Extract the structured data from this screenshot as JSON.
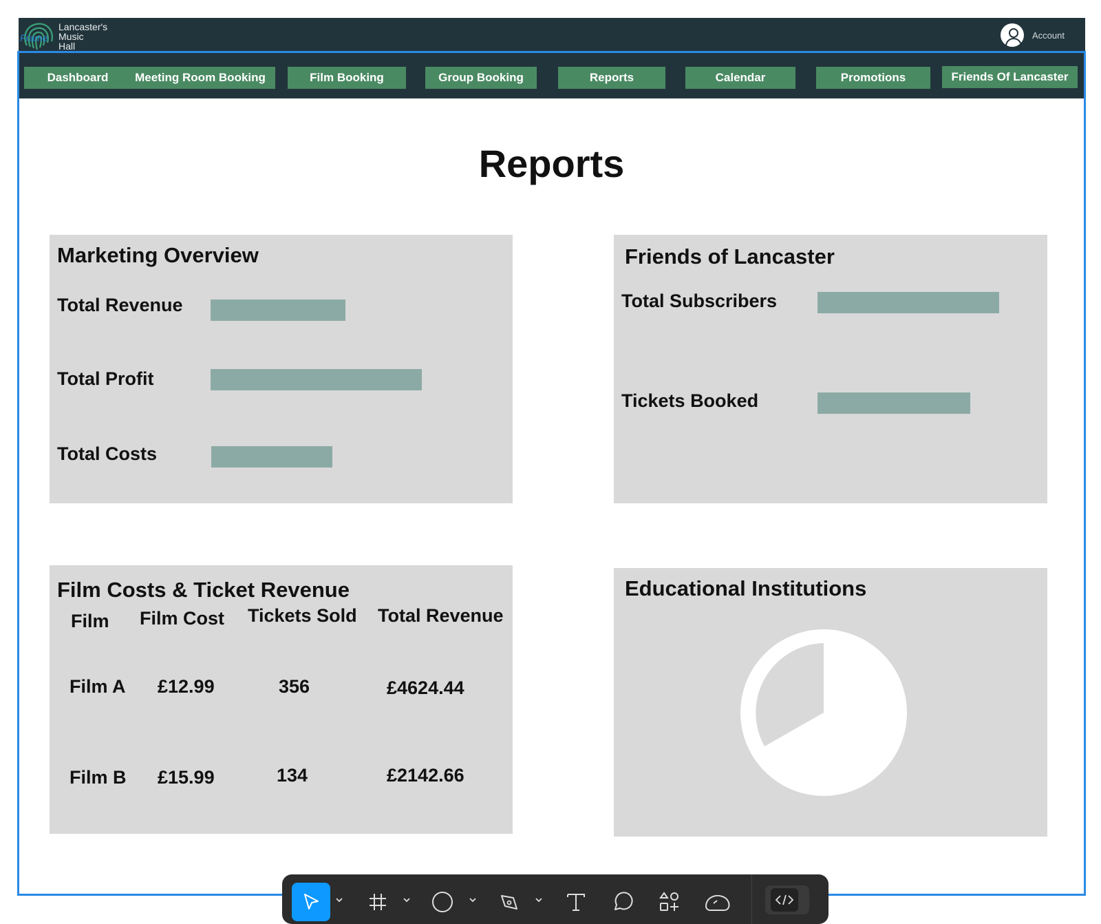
{
  "app": {
    "logo_lines": [
      "Lancaster's",
      "Music",
      "Hall"
    ],
    "frame_label": "Frame",
    "account_label": "Account"
  },
  "nav": {
    "items": [
      {
        "label": "Dashboard"
      },
      {
        "label": "Meeting Room Booking"
      },
      {
        "label": "Film Booking"
      },
      {
        "label": "Group Booking"
      },
      {
        "label": "Reports"
      },
      {
        "label": "Calendar"
      },
      {
        "label": "Promotions"
      },
      {
        "label": "Friends Of Lancaster"
      }
    ],
    "button_color": "#4a8a63"
  },
  "page": {
    "title": "Reports"
  },
  "marketing": {
    "title": "Marketing Overview",
    "metrics": [
      {
        "label": "Total Revenue"
      },
      {
        "label": "Total Profit"
      },
      {
        "label": "Total Costs"
      }
    ]
  },
  "friends": {
    "title": "Friends of Lancaster",
    "metrics": [
      {
        "label": "Total Subscribers"
      },
      {
        "label": "Tickets Booked"
      }
    ]
  },
  "film_table": {
    "title": "Film Costs & Ticket Revenue",
    "headers": [
      "Film",
      "Film Cost",
      "Tickets Sold",
      "Total Revenue"
    ],
    "rows": [
      [
        "Film A",
        "£12.99",
        "356",
        "£4624.44"
      ],
      [
        "Film B",
        "£15.99",
        "134",
        "£2142.66"
      ]
    ]
  },
  "education": {
    "title": "Educational Institutions"
  },
  "colors": {
    "bar": "#8caaa5",
    "card": "#d9d9d9",
    "header": "#22343b",
    "frame_outline": "#2a8ae6",
    "toolbar_active": "#0d99ff"
  },
  "toolbar": {
    "tools": [
      "move-tool",
      "frame-tool",
      "shape-tool",
      "pen-tool",
      "text-tool",
      "comment-tool",
      "actions-tool",
      "cloud-tool",
      "dev-mode-toggle"
    ]
  }
}
